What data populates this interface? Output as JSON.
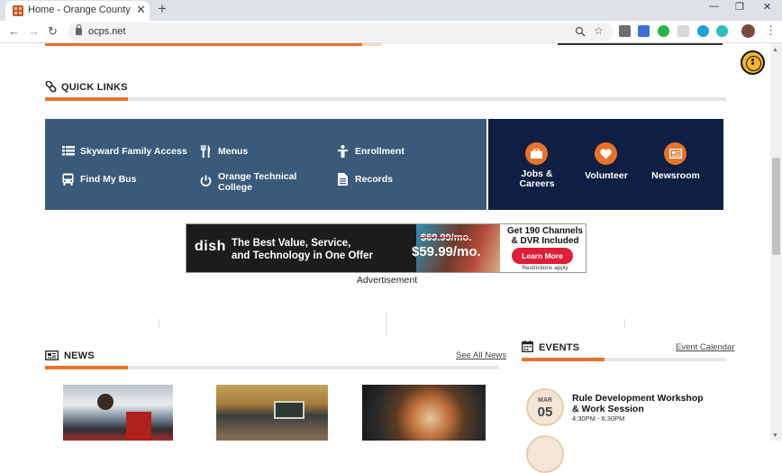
{
  "browser": {
    "tab_title": "Home - Orange County Public Sc",
    "tab_close": "✕",
    "new_tab": "+",
    "url": "ocps.net",
    "min": "—",
    "max": "❐",
    "close": "✕"
  },
  "page": {
    "quick_links": {
      "title": "QUICK LINKS",
      "items": [
        {
          "label": "Skyward Family Access",
          "icon": "list-icon"
        },
        {
          "label": "Menus",
          "icon": "utensils-icon"
        },
        {
          "label": "Enrollment",
          "icon": "person-icon"
        },
        {
          "label": "Find My Bus",
          "icon": "bus-icon"
        },
        {
          "label": "Orange Technical College",
          "icon": "power-icon"
        },
        {
          "label": "Records",
          "icon": "document-icon"
        }
      ],
      "featured": [
        {
          "label": "Jobs & Careers",
          "icon": "briefcase-icon"
        },
        {
          "label": "Volunteer",
          "icon": "heart-icon"
        },
        {
          "label": "Newsroom",
          "icon": "newspaper-icon"
        }
      ]
    },
    "ad": {
      "logo": "dish",
      "tagline_1": "The Best Value, Service,",
      "tagline_2": "and Technology in One Offer",
      "old_price": "$69.99/mo.",
      "new_price": "$59.99/mo.",
      "headline_1": "Get 190 Channels",
      "headline_2": "& DVR Included",
      "cta": "Learn More",
      "fine_print": "Restrictions apply",
      "caption": "Advertisement"
    },
    "news": {
      "title": "NEWS",
      "see_all": "See All News"
    },
    "events": {
      "title": "EVENTS",
      "calendar_link": "Event Calendar",
      "items": [
        {
          "month": "MAR",
          "day": "05",
          "title": "Rule Development Workshop & Work Session",
          "time": "4:30PM - 6:30PM"
        }
      ]
    },
    "colors": {
      "accent": "#e8722a",
      "panel_blue": "#3a5a7c",
      "panel_navy": "#0e1f43"
    }
  }
}
